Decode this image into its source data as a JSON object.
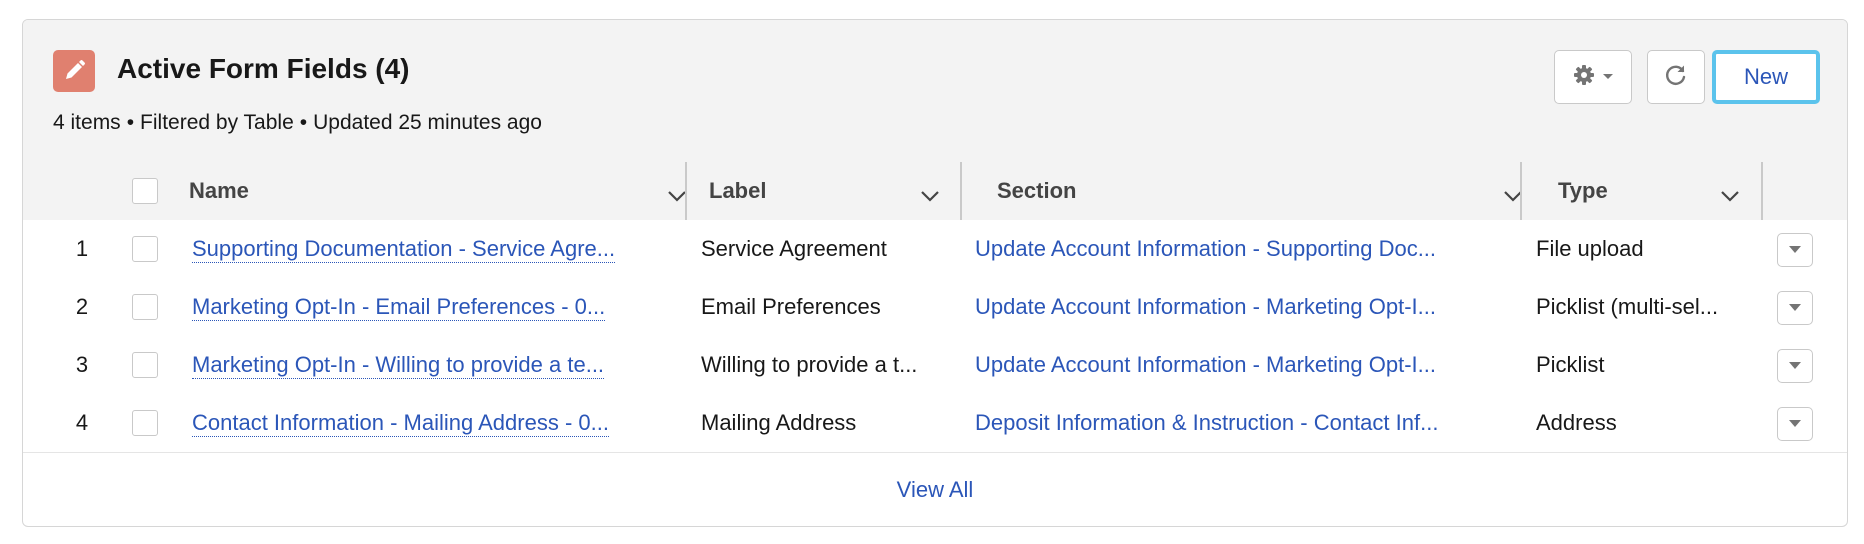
{
  "header": {
    "title": "Active Form Fields (4)",
    "meta": {
      "count": "4 items",
      "filter": "Filtered by Table",
      "updated": "Updated 25 minutes ago"
    },
    "icon": "pencil-icon",
    "icon_color": "#e0806f",
    "new_label": "New"
  },
  "table": {
    "columns": [
      "Name",
      "Label",
      "Section",
      "Type"
    ],
    "rows": [
      {
        "num": "1",
        "name": "Supporting Documentation - Service Agre...",
        "label": "Service Agreement",
        "section": "Update Account Information - Supporting Doc...",
        "type": "File upload"
      },
      {
        "num": "2",
        "name": "Marketing Opt-In - Email Preferences - 0...",
        "label": "Email Preferences",
        "section": "Update Account Information - Marketing Opt-I...",
        "type": "Picklist (multi-sel..."
      },
      {
        "num": "3",
        "name": "Marketing Opt-In - Willing to provide a te...",
        "label": "Willing to provide a t...",
        "section": "Update Account Information - Marketing Opt-I...",
        "type": "Picklist"
      },
      {
        "num": "4",
        "name": "Contact Information - Mailing Address - 0...",
        "label": "Mailing Address",
        "section": "Deposit Information & Instruction - Contact Inf...",
        "type": "Address"
      }
    ]
  },
  "footer": {
    "view_all": "View All"
  },
  "colors": {
    "link": "#2b56b8",
    "focus_ring": "#5bc3ec",
    "header_bg": "#f3f3f3"
  }
}
